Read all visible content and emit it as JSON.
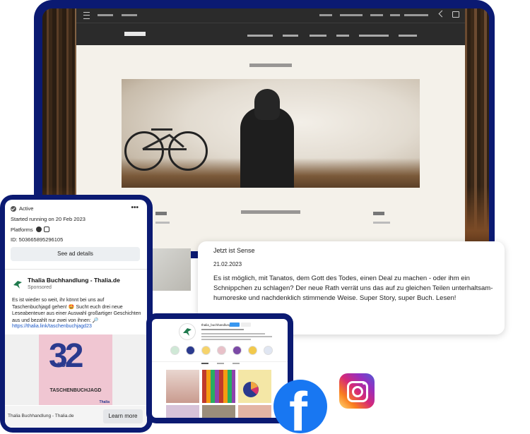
{
  "ad": {
    "status": "Active",
    "started": "Started running on 20 Feb 2023",
    "platforms_label": "Platforms",
    "id_text": "ID: 503665895296105",
    "see_details": "See ad details",
    "brand": "Thalia Buchhandlung - Thalia.de",
    "sponsored": "Sponsored",
    "body": "Es ist wieder so weit, ihr könnt bei uns auf Taschenbuchjagd gehen! 🤩 Sucht euch drei neue Leseabenteuer aus einer Auswahl großartiger Geschichten aus und bezahlt nur zwei von ihnen: 🔎",
    "link": "https://thalia.link/taschenbuchjagd23",
    "card_number": "32",
    "card_fuer": "FÜR",
    "card_title": "TASCHENBUCHJAGD",
    "card_brand": "Thalia",
    "footer": "Thalia Buchhandlung - Thalia.de",
    "learn_more": "Learn more"
  },
  "review": {
    "title": "Jetzt ist Sense",
    "date": "21.02.2023",
    "body": "Es ist möglich, mit Tanatos, dem Gott des Todes, einen Deal zu machen - oder ihm ein Schnippchen zu schlagen? Der neue Rath verrät uns das auf zu gleichen Teilen unterhaltsam-humoreske und nachdenklich stimmende Weise. Super Story, super Buch. Lesen!"
  },
  "instagram": {
    "username": "thalia_buchhandlungen"
  },
  "colors": {
    "frame": "#0b1a72",
    "facebook": "#1877f2",
    "link": "#1a56c5"
  },
  "icons": [
    "check-icon",
    "more-icon",
    "facebook-platform-icon",
    "instagram-platform-icon",
    "thalia-logo",
    "facebook-logo",
    "instagram-logo"
  ]
}
